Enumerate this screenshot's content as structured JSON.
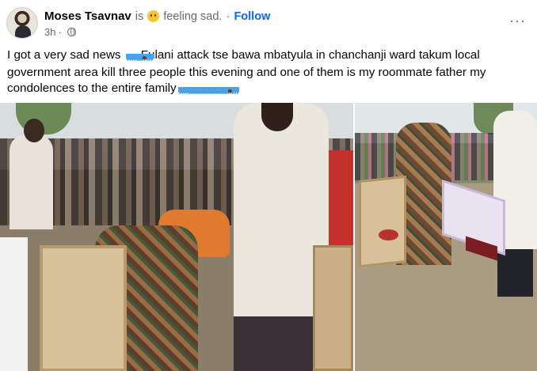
{
  "post": {
    "author": "Moses Tsavnav",
    "is_text": "is",
    "feeling": "feeling sad.",
    "separator": "·",
    "follow_label": "Follow",
    "timestamp": "3h",
    "time_separator": "·",
    "more_label": "···",
    "icons": {
      "feeling": "sad-face-icon",
      "audience": "globe-icon",
      "more": "more-options-icon",
      "reaction": "loudly-crying-face-icon"
    },
    "text_part1": "I got a very sad news",
    "text_part2": "Fulani attack tse bawa mbatyula in chanchanji ward takum local government area kill three people this evening and one of them is my roommate father my condolences to the entire family",
    "emoji_group1_count": 7,
    "emoji_group2_count": 21,
    "photos": [
      "photo-crowd-coffins",
      "photo-coffin-carried"
    ]
  },
  "colors": {
    "link": "#0866ff",
    "secondary_text": "#65676b",
    "primary_text": "#050505"
  }
}
